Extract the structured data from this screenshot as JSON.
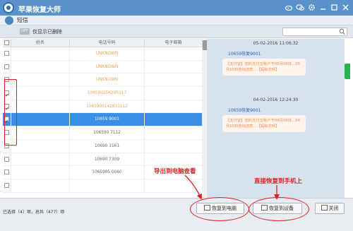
{
  "app": {
    "title": "苹果恢复大师",
    "sub_title": "短信"
  },
  "titlebar_icons": [
    "weibo-icon",
    "wechat-icon",
    "gear-icon",
    "minimize-icon",
    "maximize-icon",
    "close-icon"
  ],
  "filter": {
    "toggle_text": "OFF",
    "toggle_label": "仅显示已删除",
    "search_placeholder": ""
  },
  "table": {
    "headers": [
      "",
      "姓名",
      "电话号码",
      "电子邮箱"
    ],
    "rows": [
      {
        "checked": false,
        "contact": "",
        "phone": "UNKNOWN",
        "email": "",
        "color": "orange",
        "selected": false
      },
      {
        "checked": false,
        "contact": "",
        "phone": "UNKNOWN",
        "email": "",
        "color": "orange",
        "selected": false
      },
      {
        "checked": false,
        "contact": "",
        "phone": "UNKNOWN",
        "email": "",
        "color": "orange",
        "selected": false
      },
      {
        "checked": true,
        "contact": "",
        "phone": "106590256205117",
        "email": "",
        "color": "orange",
        "selected": false
      },
      {
        "checked": true,
        "contact": "",
        "phone": "1065900142831112",
        "email": "",
        "color": "orange",
        "selected": false
      },
      {
        "checked": true,
        "contact": "",
        "phone": "10659 9001",
        "email": "",
        "color": "white",
        "selected": true
      },
      {
        "checked": false,
        "contact": "",
        "phone": "106590  7112",
        "email": "",
        "color": "gray",
        "selected": false
      },
      {
        "checked": false,
        "contact": "",
        "phone": "10690  3161",
        "email": "",
        "color": "gray",
        "selected": false
      },
      {
        "checked": false,
        "contact": "",
        "phone": "10690  7309",
        "email": "",
        "color": "gray",
        "selected": false
      },
      {
        "checked": false,
        "contact": "",
        "phone": "1065905  0060",
        "email": "",
        "color": "gray",
        "selected": false
      },
      {
        "checked": false,
        "contact": "",
        "phone": "",
        "email": "",
        "color": "gray",
        "selected": false
      }
    ]
  },
  "chat": {
    "messages": [
      {
        "date": "05-02-2016 11:06:32",
        "sender": "10659恢复9001",
        "text": "【支付宝】您的支付宝账户于05月08日…05月10日自动还款…【蚂蚁花呗】"
      },
      {
        "date": "04-02-2016 12:24:30",
        "sender": "10659恢复9001",
        "text": "【支付宝】您的支付宝账户于04月08日…04月10日自动还款…【蚂蚁花呗】"
      }
    ]
  },
  "footer": {
    "stats": "已选择（4）项，总共（477）项",
    "recover_to_pc": "恢复到电脑",
    "recover_to_device": "恢复到设备",
    "close": "关闭"
  },
  "annotations": {
    "export_to_pc": "导出到电脑查看",
    "restore_to_phone": "直接恢复到手机上"
  },
  "colors": {
    "titlebar": "#5a93cc",
    "selection": "#3a8ee6",
    "annotation": "#e02020",
    "phone_orange": "#f0a050"
  }
}
